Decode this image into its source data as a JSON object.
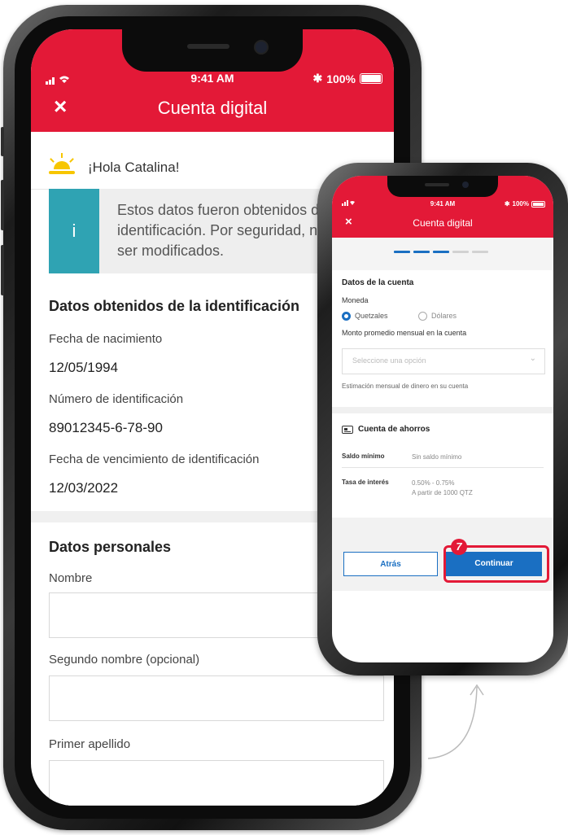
{
  "large_screen": {
    "status": {
      "time": "9:41 AM",
      "battery": "100%"
    },
    "header": {
      "title": "Cuenta digital",
      "close_icon": "×"
    },
    "greeting": "¡Hola Catalina!",
    "info": {
      "icon": "i",
      "text": "Estos datos fueron obtenidos de su identificación. Por seguridad, no pueden ser modificados."
    },
    "id_section": {
      "title": "Datos obtenidos de la identificación",
      "fields": [
        {
          "label": "Fecha de nacimiento",
          "value": "12/05/1994"
        },
        {
          "label": "Número de identificación",
          "value": "89012345-6-78-90"
        },
        {
          "label": "Fecha de vencimiento de identificación",
          "value": "12/03/2022"
        }
      ]
    },
    "personal_section": {
      "title": "Datos personales",
      "fields": [
        {
          "label": "Nombre",
          "value": ""
        },
        {
          "label": "Segundo nombre (opcional)",
          "value": ""
        },
        {
          "label": "Primer apellido",
          "value": ""
        }
      ]
    }
  },
  "small_screen": {
    "status": {
      "time": "9:41 AM",
      "battery": "100%"
    },
    "header": {
      "title": "Cuenta digital",
      "close_icon": "×"
    },
    "progress": {
      "completed_steps": 3,
      "total_steps": 5
    },
    "account_section": {
      "title": "Datos de la cuenta",
      "currency_label": "Moneda",
      "currency_options": [
        {
          "label": "Quetzales",
          "selected": true
        },
        {
          "label": "Dólares",
          "selected": false
        }
      ],
      "amount_label": "Monto promedio mensual en la cuenta",
      "amount_placeholder": "Seleccione una opción",
      "amount_hint": "Estimación mensual de dinero en su cuenta"
    },
    "savings": {
      "title": "Cuenta de ahorros",
      "rows": [
        {
          "label": "Saldo mínimo",
          "value": "Sin saldo mínimo"
        },
        {
          "label": "Tasa de interés",
          "value": "0.50% - 0.75%",
          "value2": "A partir de 1000 QTZ"
        }
      ]
    },
    "buttons": {
      "back": "Atrás",
      "next": "Continuar"
    }
  },
  "annotation": {
    "step_number": "7",
    "color": "#e31937"
  },
  "colors": {
    "brand_red": "#e31937",
    "primary_blue": "#1a6fc2",
    "info_teal": "#2fa3b3"
  }
}
